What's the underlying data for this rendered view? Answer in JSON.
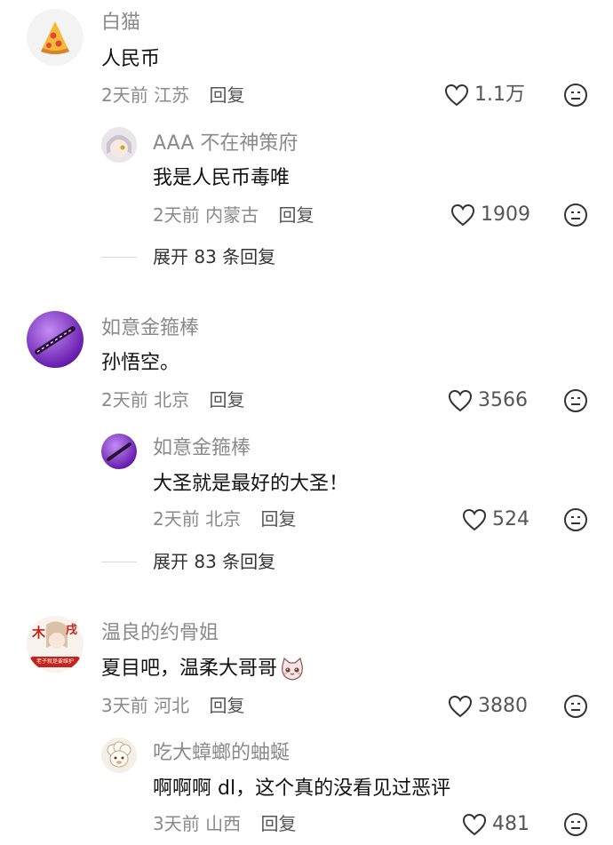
{
  "comments": [
    {
      "username": "白猫",
      "text": "人民币",
      "time": "2天前",
      "location": "江苏",
      "reply_label": "回复",
      "likes": "1.1万",
      "avatar_icon": "pizza-icon",
      "reply": {
        "username": "AAA 不在神策府",
        "text": "我是人民币毒唯",
        "time": "2天前",
        "location": "内蒙古",
        "reply_label": "回复",
        "likes": "1909",
        "avatar_icon": "anime-avatar-icon"
      },
      "expand_label": "展开 83 条回复"
    },
    {
      "username": "如意金箍棒",
      "text": "孙悟空。",
      "time": "2天前",
      "location": "北京",
      "reply_label": "回复",
      "likes": "3566",
      "avatar_icon": "golden-staff-icon",
      "reply": {
        "username": "如意金箍棒",
        "text": "大圣就是最好的大圣！",
        "time": "2天前",
        "location": "北京",
        "reply_label": "回复",
        "likes": "524",
        "avatar_icon": "golden-staff-icon"
      },
      "expand_label": "展开 83 条回复"
    },
    {
      "username": "温良的约骨姐",
      "text": "夏目吧，温柔大哥哥",
      "time": "3天前",
      "location": "河北",
      "reply_label": "回复",
      "likes": "3880",
      "avatar_icon": "character-avatar-icon",
      "avatar_badge": "老子就是要维护",
      "reply": {
        "username": "吃大蟑螂的蚰蜒",
        "text": "啊啊啊 dl，这个真的没看见过恶评",
        "time": "3天前",
        "location": "山西",
        "reply_label": "回复",
        "likes": "481",
        "avatar_icon": "sheep-avatar-icon"
      }
    }
  ],
  "colors": {
    "secondary_text": "#8a8a8a",
    "primary_text": "#111111",
    "accent_purple": "#8a2be2"
  }
}
